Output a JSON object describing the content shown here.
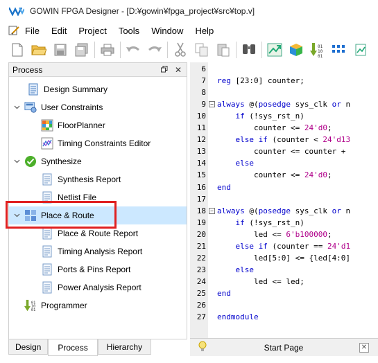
{
  "window": {
    "title": "GOWIN FPGA Designer - [D:¥gowin¥fpga_project¥src¥top.v]"
  },
  "menu": {
    "items": [
      "File",
      "Edit",
      "Project",
      "Tools",
      "Window",
      "Help"
    ]
  },
  "toolbar": {
    "buttons": [
      "new-file-icon",
      "open-folder-icon",
      "save-icon",
      "save-all-icon",
      "print-icon",
      "undo-icon",
      "redo-icon",
      "cut-icon",
      "copy-icon",
      "paste-icon",
      "find-icon",
      "run-icon",
      "package-icon",
      "program-icon",
      "grid-icon"
    ]
  },
  "panel": {
    "title": "Process",
    "items": [
      {
        "label": "Design Summary",
        "level": 1,
        "icon": "summary-icon"
      },
      {
        "label": "User Constraints",
        "level": 0,
        "icon": "constraints-icon",
        "expanded": true
      },
      {
        "label": "FloorPlanner",
        "level": 1,
        "icon": "floorplanner-icon"
      },
      {
        "label": "Timing Constraints Editor",
        "level": 1,
        "icon": "timing-editor-icon"
      },
      {
        "label": "Synthesize",
        "level": 0,
        "icon": "check-icon",
        "expanded": true
      },
      {
        "label": "Synthesis Report",
        "level": 1,
        "icon": "report-icon"
      },
      {
        "label": "Netlist File",
        "level": 1,
        "icon": "report-icon"
      },
      {
        "label": "Place & Route",
        "level": 0,
        "icon": "place-route-icon",
        "expanded": true,
        "selected": true
      },
      {
        "label": "Place & Route Report",
        "level": 1,
        "icon": "report-icon"
      },
      {
        "label": "Timing Analysis Report",
        "level": 1,
        "icon": "report-icon"
      },
      {
        "label": "Ports & Pins Report",
        "level": 1,
        "icon": "report-icon"
      },
      {
        "label": "Power Analysis Report",
        "level": 1,
        "icon": "report-icon"
      },
      {
        "label": "Programmer",
        "level": 0,
        "icon": "programmer-icon"
      }
    ]
  },
  "tabs": [
    {
      "label": "Design",
      "active": false
    },
    {
      "label": "Process",
      "active": true
    },
    {
      "label": "Hierarchy",
      "active": false
    }
  ],
  "editor": {
    "lines": [
      {
        "n": "6",
        "text": ""
      },
      {
        "n": "7",
        "text": "reg [23:0] counter;"
      },
      {
        "n": "8",
        "text": ""
      },
      {
        "n": "9",
        "text": "always @(posedge sys_clk or n",
        "fold": true
      },
      {
        "n": "10",
        "text": "    if (!sys_rst_n)"
      },
      {
        "n": "11",
        "text": "        counter <= 24'd0;"
      },
      {
        "n": "12",
        "text": "    else if (counter < 24'd13"
      },
      {
        "n": "13",
        "text": "        counter <= counter +"
      },
      {
        "n": "14",
        "text": "    else"
      },
      {
        "n": "15",
        "text": "        counter <= 24'd0;"
      },
      {
        "n": "16",
        "text": "end"
      },
      {
        "n": "17",
        "text": ""
      },
      {
        "n": "18",
        "text": "always @(posedge sys_clk or n",
        "fold": true
      },
      {
        "n": "19",
        "text": "    if (!sys_rst_n)"
      },
      {
        "n": "20",
        "text": "        led <= 6'b100000;"
      },
      {
        "n": "21",
        "text": "    else if (counter == 24'd1"
      },
      {
        "n": "22",
        "text": "        led[5:0] <= {led[4:0]"
      },
      {
        "n": "23",
        "text": "    else"
      },
      {
        "n": "24",
        "text": "        led <= led;"
      },
      {
        "n": "25",
        "text": "end"
      },
      {
        "n": "26",
        "text": ""
      },
      {
        "n": "27",
        "text": "endmodule"
      }
    ]
  },
  "startpage": {
    "title": "Start Page"
  },
  "colors": {
    "selection": "#cce8ff",
    "highlight": "#e02020",
    "keyword": "#0000cc",
    "number": "#b0008a"
  }
}
